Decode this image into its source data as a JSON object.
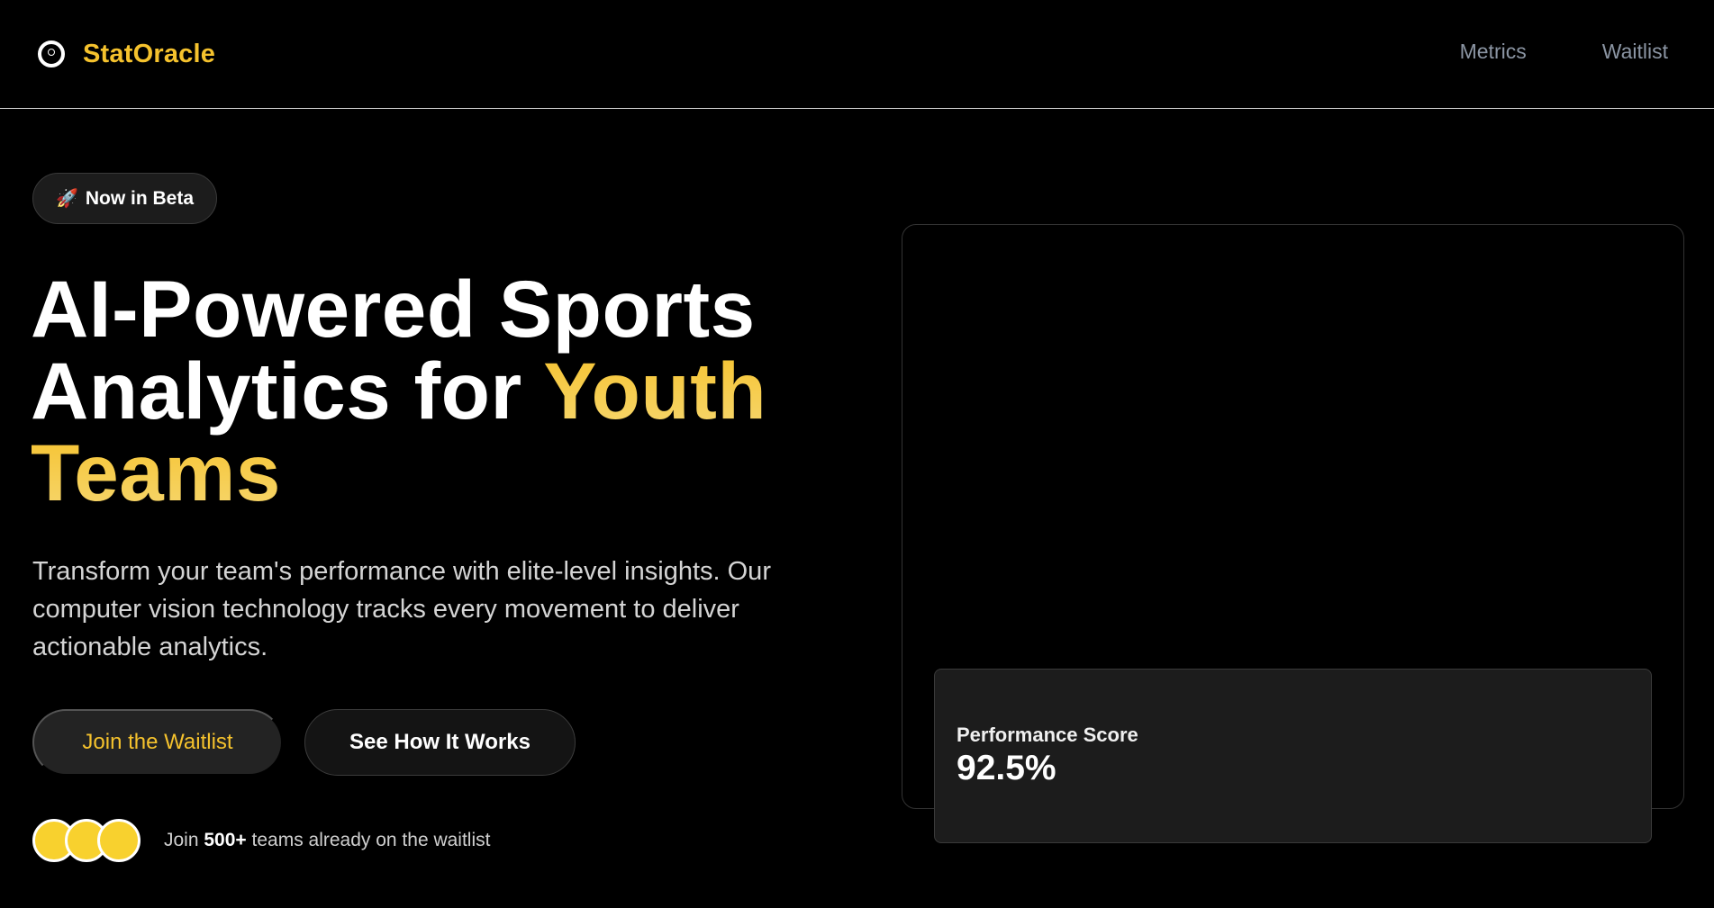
{
  "brand": {
    "name": "StatOracle",
    "icon": "eye-logo-icon"
  },
  "nav": {
    "links": [
      "Metrics",
      "Waitlist"
    ]
  },
  "hero": {
    "badge_icon": "🚀",
    "badge_label": "Now in Beta",
    "headline_part1": "AI-Powered Sports Analytics for ",
    "headline_highlight": "Youth Teams",
    "subtext": "Transform your team's performance with elite-level insights. Our computer vision technology tracks every movement to deliver actionable analytics.",
    "primary_cta": "Join the Waitlist",
    "secondary_cta": "See How It Works",
    "social_prefix": "Join ",
    "social_count": "500+",
    "social_suffix": " teams already on the waitlist"
  },
  "score": {
    "label": "Performance Score",
    "value": "92.5%"
  },
  "colors": {
    "accent": "#f5c22d",
    "background": "#000000",
    "card": "#1c1c1c",
    "avatar": "#f8d12e"
  }
}
